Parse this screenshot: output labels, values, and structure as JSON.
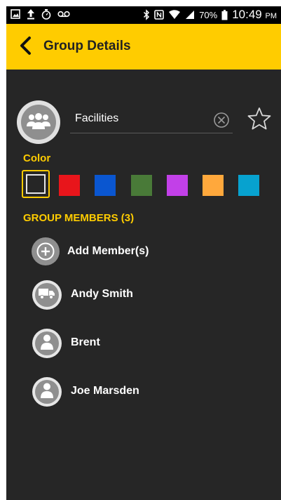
{
  "status_bar": {
    "battery": "70%",
    "time": "10:49",
    "ampm": "PM",
    "icons": [
      "image-icon",
      "upload-icon",
      "stopwatch-icon",
      "voicemail-icon",
      "bluetooth-icon",
      "nfc-icon",
      "wifi-icon",
      "signal-icon",
      "battery-icon"
    ]
  },
  "app_bar": {
    "title": "Group Details",
    "back_icon": "chevron-left-icon",
    "background": "#ffcc00"
  },
  "group": {
    "name": "Facilities",
    "avatar_icon": "group-icon",
    "clear_icon": "clear-circle-icon",
    "favorite_icon": "star-outline-icon"
  },
  "color_section": {
    "label": "Color",
    "selected_index": 0,
    "swatches": [
      {
        "name": "none",
        "color": "#262626"
      },
      {
        "name": "red",
        "color": "#e8151b"
      },
      {
        "name": "blue",
        "color": "#0a56d0"
      },
      {
        "name": "green",
        "color": "#497a38"
      },
      {
        "name": "purple",
        "color": "#c240e8"
      },
      {
        "name": "orange",
        "color": "#ffa83c"
      },
      {
        "name": "cyan",
        "color": "#07a2cf"
      }
    ]
  },
  "members_section": {
    "label": "GROUP MEMBERS (3)",
    "add_label": "Add Member(s)",
    "add_icon": "plus-circle-icon",
    "members": [
      {
        "name": "Andy Smith",
        "icon": "truck-icon"
      },
      {
        "name": "Brent",
        "icon": "person-icon"
      },
      {
        "name": "Joe Marsden",
        "icon": "person-icon"
      }
    ]
  },
  "theme": {
    "accent": "#ffcc00",
    "background": "#262626"
  }
}
